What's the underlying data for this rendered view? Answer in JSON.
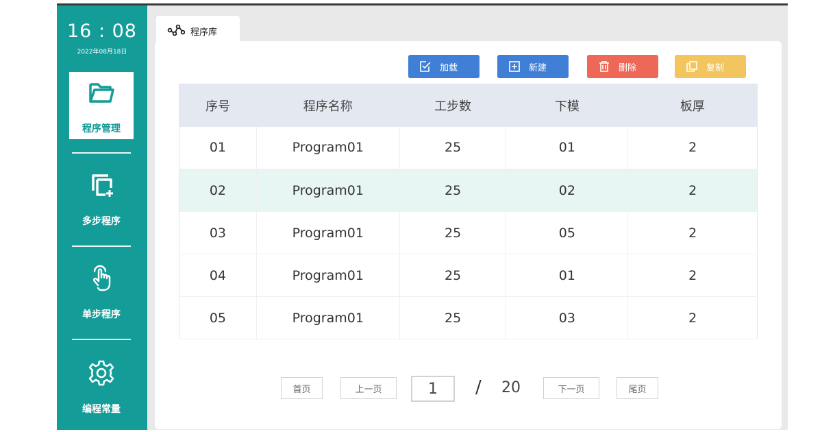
{
  "clock": {
    "time": "16 : 08",
    "date": "2022年08月18日"
  },
  "sidebar": {
    "items": [
      {
        "label": "程序管理",
        "icon": "folder-icon",
        "active": true
      },
      {
        "label": "多步程序",
        "icon": "multi-copy-add-icon",
        "active": false
      },
      {
        "label": "单步程序",
        "icon": "hand-pointer-icon",
        "active": false
      },
      {
        "label": "编程常量",
        "icon": "gear-icon",
        "active": false
      }
    ]
  },
  "tab": {
    "label": "程序库",
    "icon": "graph-nodes-icon"
  },
  "toolbar": {
    "load_label": "加载",
    "new_label": "新建",
    "delete_label": "删除",
    "copy_label": "复制"
  },
  "table": {
    "headers": [
      "序号",
      "程序名称",
      "工步数",
      "下模",
      "板厚"
    ],
    "rows": [
      [
        "01",
        "Program01",
        "25",
        "01",
        "2"
      ],
      [
        "02",
        "Program01",
        "25",
        "02",
        "2"
      ],
      [
        "03",
        "Program01",
        "25",
        "05",
        "2"
      ],
      [
        "04",
        "Program01",
        "25",
        "01",
        "2"
      ],
      [
        "05",
        "Program01",
        "25",
        "03",
        "2"
      ]
    ],
    "selected_row": 1
  },
  "pagination": {
    "first_label": "首页",
    "prev_label": "上一页",
    "current": "1",
    "separator": "/",
    "total": "20",
    "next_label": "下一页",
    "last_label": "尾页"
  },
  "colors": {
    "sidebar": "#139c98",
    "blue_button": "#3f7fd6",
    "red_button": "#ee6857",
    "yellow_button": "#f3c55f",
    "selected_row": "#e7f5f3",
    "header_row": "#e4e8f1"
  }
}
